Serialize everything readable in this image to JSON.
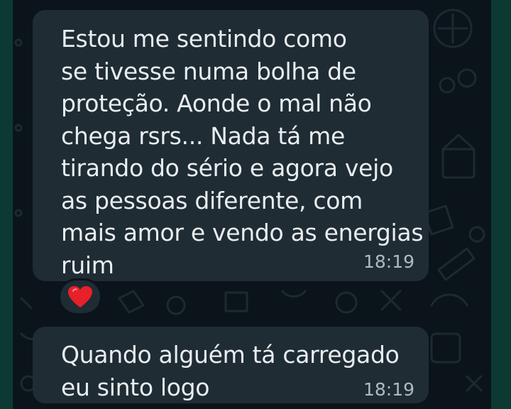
{
  "messages": [
    {
      "text": "Estou me sentindo como\nse tivesse numa bolha de\nproteção. Aonde o mal não\nchega rsrs... Nada tá me\ntirando do sério e agora vejo\nas pessoas diferente, com\nmais amor e vendo as energias\nruim",
      "time": "18:19",
      "reaction": "red-heart-icon"
    },
    {
      "text": "Quando alguém tá carregado\neu sinto logo",
      "time": "18:19"
    }
  ],
  "colors": {
    "chat_background": "#0b141a",
    "bubble": "#1f2c34",
    "text": "#e9edef",
    "timestamp": "#aebac1",
    "frame": "#0c3a33",
    "heart": "#e8202a"
  }
}
